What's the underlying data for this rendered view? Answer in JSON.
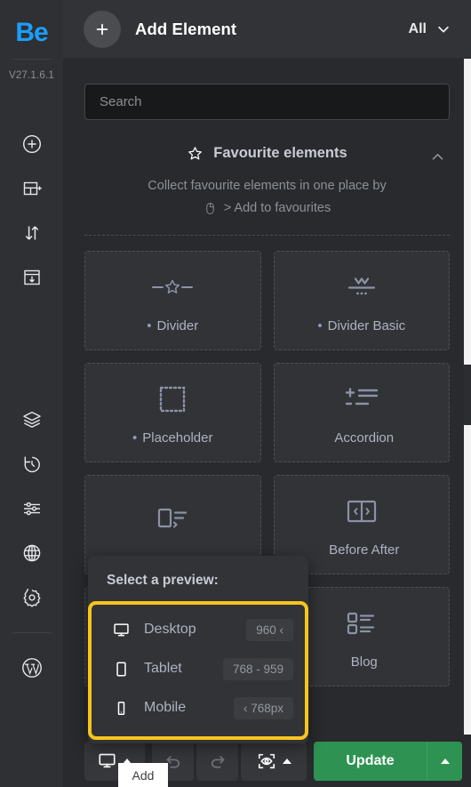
{
  "rail": {
    "logo": "Be",
    "version": "V27.1.6.1",
    "icons_top": [
      {
        "name": "add-circle-icon",
        "label": "Add"
      },
      {
        "name": "add-section-icon",
        "label": "Add section"
      },
      {
        "name": "sort-updown-icon",
        "label": "Reorder"
      },
      {
        "name": "import-window-icon",
        "label": "Import"
      }
    ],
    "icons_mid": [
      {
        "name": "layers-icon",
        "label": "Layers"
      },
      {
        "name": "history-revert-icon",
        "label": "History"
      },
      {
        "name": "sliders-icon",
        "label": "Settings sliders"
      },
      {
        "name": "globe-icon",
        "label": "Global"
      },
      {
        "name": "gear-icon",
        "label": "Settings"
      }
    ],
    "icons_bottom": [
      {
        "name": "wordpress-icon",
        "label": "WordPress"
      }
    ]
  },
  "topbar": {
    "add_icon": "plus-icon",
    "title": "Add Element",
    "filter_label": "All",
    "filter_icon": "chevron-down-icon"
  },
  "search": {
    "placeholder": "Search",
    "value": ""
  },
  "favourites": {
    "star_icon": "star-icon",
    "title": "Favourite elements",
    "collapse_icon": "chevron-up-icon",
    "description_line1": "Collect favourite elements in one place by",
    "mouse_icon": "mouse-icon",
    "description_line2": "> Add to favourites"
  },
  "grid": {
    "cards": [
      {
        "icon": "divider-star-icon",
        "label": "Divider",
        "bullet": "•"
      },
      {
        "icon": "divider-basic-icon",
        "label": "Divider Basic",
        "bullet": "•"
      },
      {
        "icon": "placeholder-icon",
        "label": "Placeholder",
        "bullet": "•"
      },
      {
        "icon": "accordion-icon",
        "label": "Accordion",
        "bullet": ""
      },
      {
        "icon": "media-list-icon",
        "label": "",
        "bullet": ""
      },
      {
        "icon": "before-after-icon",
        "label": "Before After",
        "bullet": ""
      },
      {
        "icon": "blank-icon",
        "label": "",
        "bullet": ""
      },
      {
        "icon": "blog-list-icon",
        "label": "Blog",
        "bullet": ""
      }
    ]
  },
  "popup": {
    "title": "Select a preview:",
    "highlight_color": "#f7c51e",
    "options": [
      {
        "icon": "desktop-icon",
        "label": "Desktop",
        "badge": "960 ‹"
      },
      {
        "icon": "tablet-icon",
        "label": "Tablet",
        "badge": "768 - 959"
      },
      {
        "icon": "mobile-icon",
        "label": "Mobile",
        "badge": "‹ 768px"
      }
    ]
  },
  "bottombar": {
    "device_icon": "desktop-icon",
    "device_caret": "caret-up-icon",
    "undo_icon": "undo-icon",
    "redo_icon": "redo-icon",
    "preview_icon": "eye-frame-icon",
    "preview_caret": "caret-up-icon",
    "update_label": "Update",
    "update_caret": "caret-up-icon",
    "update_color": "#2e9352"
  },
  "tooltip": {
    "text": "Add"
  }
}
